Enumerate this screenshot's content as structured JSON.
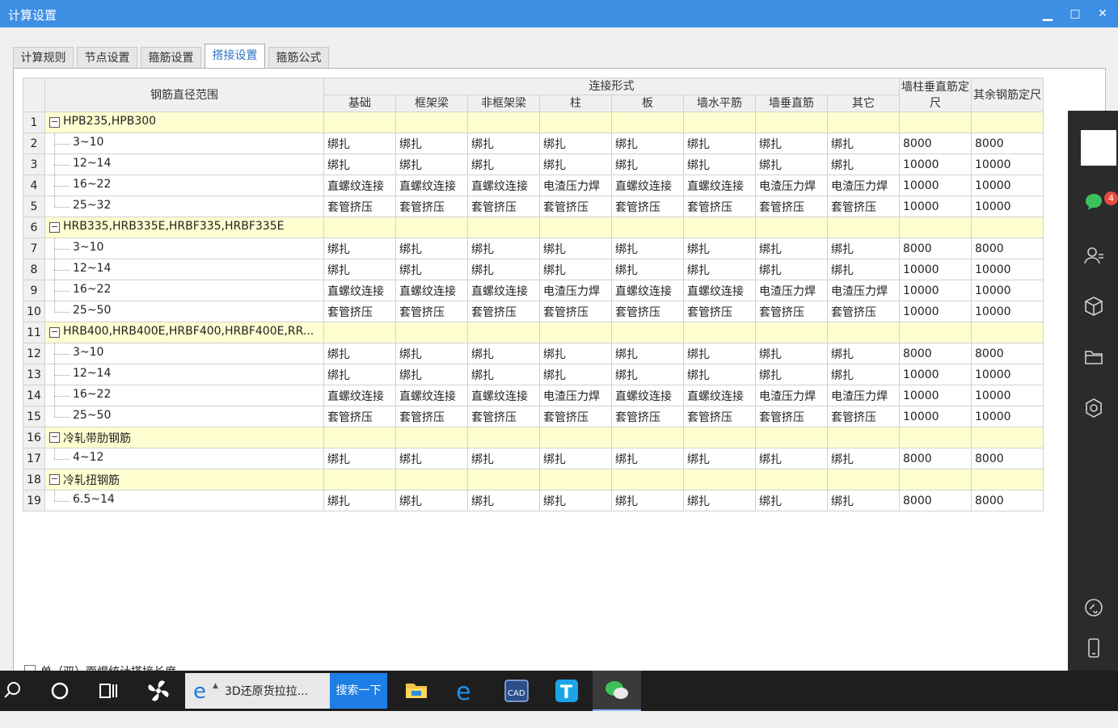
{
  "window": {
    "title": "计算设置",
    "minimize": "▁",
    "maximize": "□",
    "close": "✕"
  },
  "tabs": [
    {
      "label": "计算规则"
    },
    {
      "label": "节点设置"
    },
    {
      "label": "箍筋设置"
    },
    {
      "label": "搭接设置",
      "active": true
    },
    {
      "label": "箍筋公式"
    }
  ],
  "table": {
    "headers": {
      "range": "钢筋直径范围",
      "connection": "连接形式",
      "columns": [
        "基础",
        "框架梁",
        "非框架梁",
        "柱",
        "板",
        "墙水平筋",
        "墙垂直筋",
        "其它"
      ],
      "wall_col_len": "墙柱垂直筋定尺",
      "other_len": "其余钢筋定尺"
    },
    "rows": [
      {
        "num": "1",
        "group": true,
        "name": "HPB235,HPB300"
      },
      {
        "num": "2",
        "name": "3~10",
        "cells": [
          "绑扎",
          "绑扎",
          "绑扎",
          "绑扎",
          "绑扎",
          "绑扎",
          "绑扎",
          "绑扎",
          "8000",
          "8000"
        ]
      },
      {
        "num": "3",
        "name": "12~14",
        "cells": [
          "绑扎",
          "绑扎",
          "绑扎",
          "绑扎",
          "绑扎",
          "绑扎",
          "绑扎",
          "绑扎",
          "10000",
          "10000"
        ]
      },
      {
        "num": "4",
        "name": "16~22",
        "cells": [
          "直螺纹连接",
          "直螺纹连接",
          "直螺纹连接",
          "电渣压力焊",
          "直螺纹连接",
          "直螺纹连接",
          "电渣压力焊",
          "电渣压力焊",
          "10000",
          "10000"
        ]
      },
      {
        "num": "5",
        "name": "25~32",
        "last": true,
        "cells": [
          "套管挤压",
          "套管挤压",
          "套管挤压",
          "套管挤压",
          "套管挤压",
          "套管挤压",
          "套管挤压",
          "套管挤压",
          "10000",
          "10000"
        ]
      },
      {
        "num": "6",
        "group": true,
        "name": "HRB335,HRB335E,HRBF335,HRBF335E"
      },
      {
        "num": "7",
        "name": "3~10",
        "cells": [
          "绑扎",
          "绑扎",
          "绑扎",
          "绑扎",
          "绑扎",
          "绑扎",
          "绑扎",
          "绑扎",
          "8000",
          "8000"
        ]
      },
      {
        "num": "8",
        "name": "12~14",
        "cells": [
          "绑扎",
          "绑扎",
          "绑扎",
          "绑扎",
          "绑扎",
          "绑扎",
          "绑扎",
          "绑扎",
          "10000",
          "10000"
        ]
      },
      {
        "num": "9",
        "name": "16~22",
        "cells": [
          "直螺纹连接",
          "直螺纹连接",
          "直螺纹连接",
          "电渣压力焊",
          "直螺纹连接",
          "直螺纹连接",
          "电渣压力焊",
          "电渣压力焊",
          "10000",
          "10000"
        ]
      },
      {
        "num": "10",
        "name": "25~50",
        "last": true,
        "cells": [
          "套管挤压",
          "套管挤压",
          "套管挤压",
          "套管挤压",
          "套管挤压",
          "套管挤压",
          "套管挤压",
          "套管挤压",
          "10000",
          "10000"
        ]
      },
      {
        "num": "11",
        "group": true,
        "name": "HRB400,HRB400E,HRBF400,HRBF400E,RR..."
      },
      {
        "num": "12",
        "name": "3~10",
        "cells": [
          "绑扎",
          "绑扎",
          "绑扎",
          "绑扎",
          "绑扎",
          "绑扎",
          "绑扎",
          "绑扎",
          "8000",
          "8000"
        ]
      },
      {
        "num": "13",
        "name": "12~14",
        "cells": [
          "绑扎",
          "绑扎",
          "绑扎",
          "绑扎",
          "绑扎",
          "绑扎",
          "绑扎",
          "绑扎",
          "10000",
          "10000"
        ]
      },
      {
        "num": "14",
        "name": "16~22",
        "cells": [
          "直螺纹连接",
          "直螺纹连接",
          "直螺纹连接",
          "电渣压力焊",
          "直螺纹连接",
          "直螺纹连接",
          "电渣压力焊",
          "电渣压力焊",
          "10000",
          "10000"
        ]
      },
      {
        "num": "15",
        "name": "25~50",
        "last": true,
        "cells": [
          "套管挤压",
          "套管挤压",
          "套管挤压",
          "套管挤压",
          "套管挤压",
          "套管挤压",
          "套管挤压",
          "套管挤压",
          "10000",
          "10000"
        ]
      },
      {
        "num": "16",
        "group": true,
        "name": "冷轧带肋钢筋"
      },
      {
        "num": "17",
        "name": "4~12",
        "last": true,
        "cells": [
          "绑扎",
          "绑扎",
          "绑扎",
          "绑扎",
          "绑扎",
          "绑扎",
          "绑扎",
          "绑扎",
          "8000",
          "8000"
        ]
      },
      {
        "num": "18",
        "group": true,
        "name": "冷轧扭钢筋"
      },
      {
        "num": "19",
        "name": "6.5~14",
        "last": true,
        "cells": [
          "绑扎",
          "绑扎",
          "绑扎",
          "绑扎",
          "绑扎",
          "绑扎",
          "绑扎",
          "绑扎",
          "8000",
          "8000"
        ]
      }
    ]
  },
  "checkbox": {
    "label": "单（双）面焊统计搭接长度"
  },
  "sidebar": {
    "badge": "4",
    "icons": [
      "chat-icon",
      "contacts-icon",
      "cube-icon",
      "folder-icon",
      "settings-icon",
      "mini-program-icon",
      "phone-icon"
    ]
  },
  "taskbar": {
    "ie_label": "3D还原货拉拉...",
    "search_label": "搜索一下",
    "icons": [
      "search-icon",
      "cortana-icon",
      "task-view-icon",
      "fan-icon",
      "ie-icon",
      "file-explorer-icon",
      "edge-icon",
      "cad-icon",
      "text-app-icon",
      "wechat-icon"
    ]
  }
}
